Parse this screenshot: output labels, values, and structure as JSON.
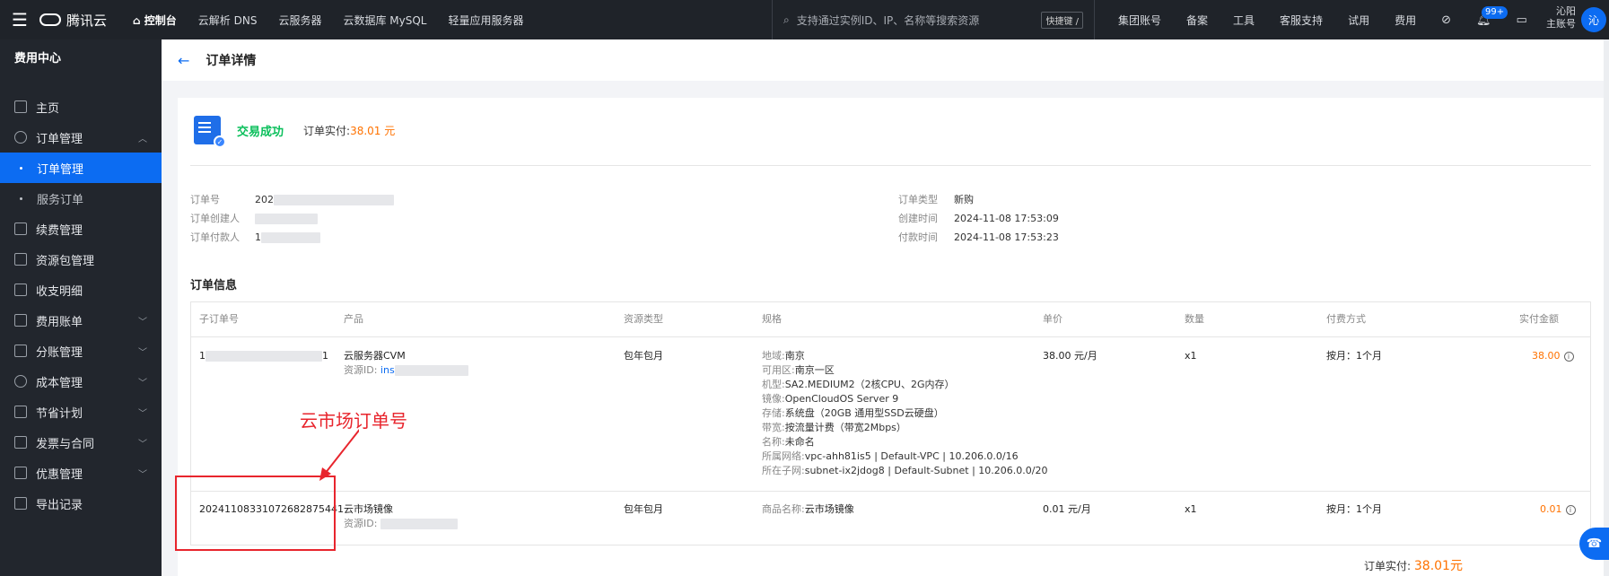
{
  "topbar": {
    "brand": "腾讯云",
    "nav": [
      "控制台",
      "云解析 DNS",
      "云服务器",
      "云数据库 MySQL",
      "轻量应用服务器"
    ],
    "search_placeholder": "支持通过实例ID、IP、名称等搜索资源",
    "shortcut": "快捷键 /",
    "right_links": [
      "集团账号",
      "备案",
      "工具",
      "客服支持",
      "试用",
      "费用"
    ],
    "badge": "99+",
    "user_name": "沁阳",
    "user_role": "主账号",
    "avatar_text": "沁"
  },
  "sidebar": {
    "title": "费用中心",
    "items": [
      {
        "label": "主页"
      },
      {
        "label": "订单管理"
      },
      {
        "label": "订单管理"
      },
      {
        "label": "服务订单"
      },
      {
        "label": "续费管理"
      },
      {
        "label": "资源包管理"
      },
      {
        "label": "收支明细"
      },
      {
        "label": "费用账单"
      },
      {
        "label": "分账管理"
      },
      {
        "label": "成本管理"
      },
      {
        "label": "节省计划"
      },
      {
        "label": "发票与合同"
      },
      {
        "label": "优惠管理"
      },
      {
        "label": "导出记录"
      }
    ]
  },
  "page": {
    "title": "订单详情"
  },
  "status": {
    "text": "交易成功",
    "paid_label": "订单实付:",
    "paid_value": "38.01 元"
  },
  "order_info": {
    "left": [
      {
        "label": "订单号",
        "value": "202"
      },
      {
        "label": "订单创建人",
        "value": ""
      },
      {
        "label": "订单付款人",
        "value": "1"
      }
    ],
    "right": [
      {
        "label": "订单类型",
        "value": "新购"
      },
      {
        "label": "创建时间",
        "value": "2024-11-08 17:53:09"
      },
      {
        "label": "付款时间",
        "value": "2024-11-08 17:53:23"
      }
    ]
  },
  "section_title": "订单信息",
  "table": {
    "headers": [
      "子订单号",
      "产品",
      "资源类型",
      "规格",
      "单价",
      "数量",
      "付费方式",
      "实付金额"
    ],
    "rows": [
      {
        "sub_order": "1",
        "sub_order_tail": "1",
        "product": "云服务器CVM",
        "resource_label": "资源ID:",
        "resource_value": "ins",
        "resource_type": "包年包月",
        "specs": [
          {
            "k": "地域:",
            "v": "南京"
          },
          {
            "k": "可用区:",
            "v": "南京一区"
          },
          {
            "k": "机型:",
            "v": "SA2.MEDIUM2（2核CPU、2G内存）"
          },
          {
            "k": "镜像:",
            "v": "OpenCloudOS Server 9"
          },
          {
            "k": "存储:",
            "v": "系统盘（20GB 通用型SSD云硬盘）"
          },
          {
            "k": "带宽:",
            "v": "按流量计费（带宽2Mbps）"
          },
          {
            "k": "名称:",
            "v": "未命名"
          },
          {
            "k": "所属网络:",
            "v": "vpc-ahh81is5 | Default-VPC | 10.206.0.0/16"
          },
          {
            "k": "所在子网:",
            "v": "subnet-ix2jdog8 | Default-Subnet | 10.206.0.0/20"
          }
        ],
        "unit_price": "38.00 元/月",
        "quantity": "x1",
        "billing": "按月：1个月",
        "amount": "38.00"
      },
      {
        "sub_order": "20241108331072682875441",
        "product": "云市场镜像",
        "resource_label": "资源ID:",
        "resource_value": "",
        "resource_type": "包年包月",
        "spec_k": "商品名称:",
        "spec_v": "云市场镜像",
        "unit_price": "0.01 元/月",
        "quantity": "x1",
        "billing": "按月：1个月",
        "amount": "0.01"
      }
    ]
  },
  "annotation": {
    "text": "云市场订单号"
  },
  "footer": {
    "label": "订单实付:",
    "value": "38.01元"
  }
}
